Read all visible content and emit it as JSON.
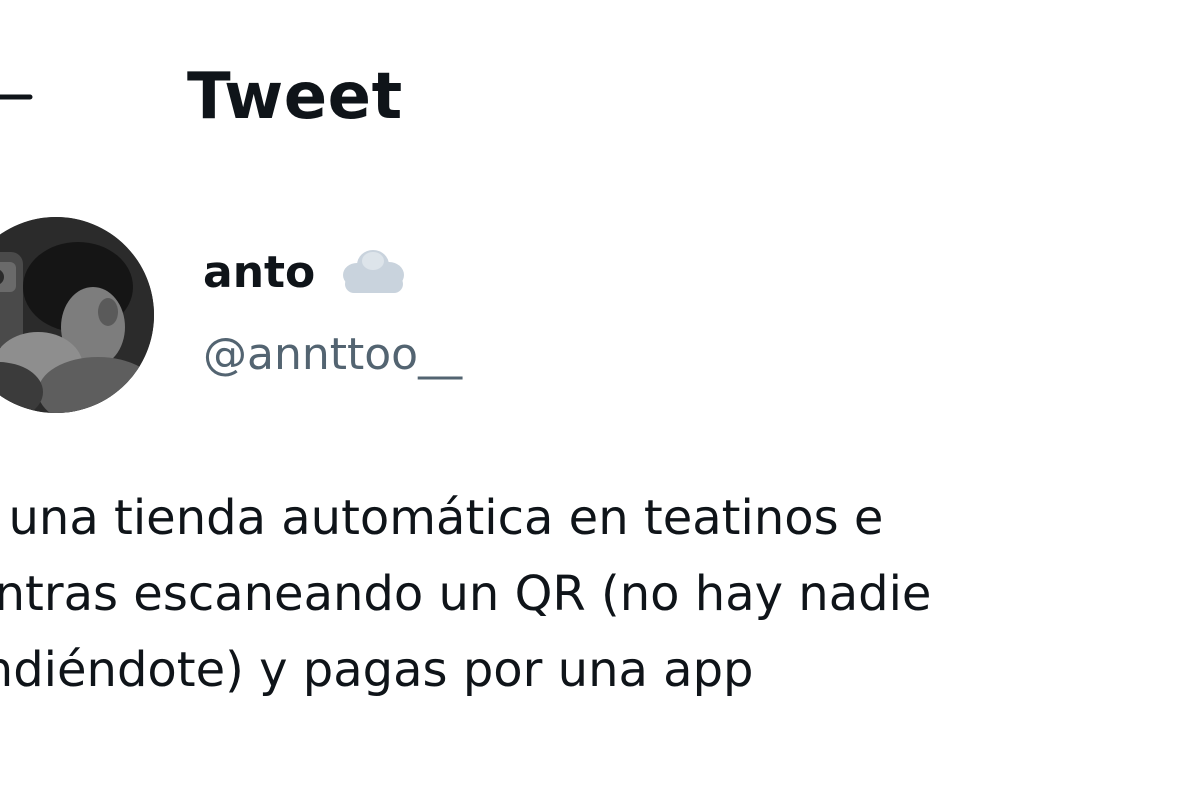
{
  "header": {
    "title": "Tweet",
    "back_icon": "arrow-left-icon"
  },
  "author": {
    "display_name": "anto",
    "emoji_icon": "cloud-icon",
    "username": "@annttoo__",
    "avatar_icon": "avatar"
  },
  "tweet": {
    "lines": [
      "hay una tienda automática en teatinos e",
      "mientras escaneando un QR (no hay nadie",
      "atendiéndote) y pagas por una app"
    ]
  },
  "colors": {
    "text": "#0f1419",
    "secondary": "#536471",
    "background": "#ffffff",
    "cloud": "#c9d3dd"
  }
}
